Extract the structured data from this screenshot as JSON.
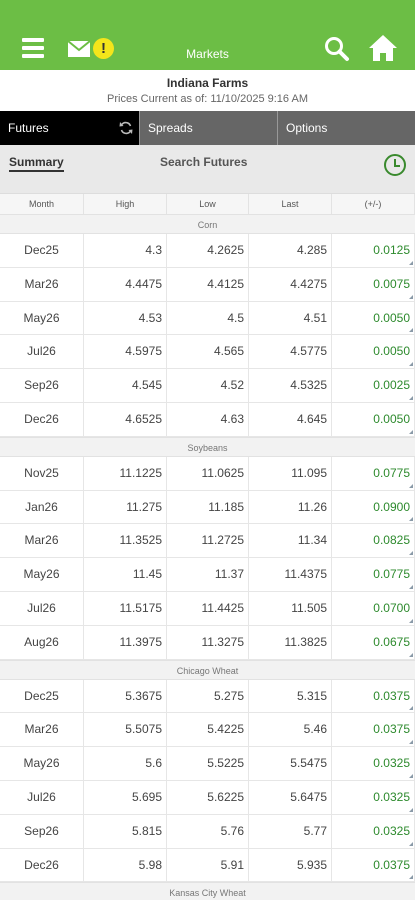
{
  "header": {
    "title": "Markets",
    "alert_badge": "!"
  },
  "company": "Indiana Farms",
  "as_of": "Prices Current as of: 11/10/2025 9:16 AM",
  "tabs": {
    "futures": "Futures",
    "spreads": "Spreads",
    "options": "Options"
  },
  "subnav": {
    "summary": "Summary",
    "search": "Search Futures"
  },
  "columns": [
    "Month",
    "High",
    "Low",
    "Last",
    "(+/-)"
  ],
  "groups": [
    {
      "name": "Corn",
      "rows": [
        [
          "Dec25",
          "4.3",
          "4.2625",
          "4.285",
          "0.0125"
        ],
        [
          "Mar26",
          "4.4475",
          "4.4125",
          "4.4275",
          "0.0075"
        ],
        [
          "May26",
          "4.53",
          "4.5",
          "4.51",
          "0.0050"
        ],
        [
          "Jul26",
          "4.5975",
          "4.565",
          "4.5775",
          "0.0050"
        ],
        [
          "Sep26",
          "4.545",
          "4.52",
          "4.5325",
          "0.0025"
        ],
        [
          "Dec26",
          "4.6525",
          "4.63",
          "4.645",
          "0.0050"
        ]
      ]
    },
    {
      "name": "Soybeans",
      "rows": [
        [
          "Nov25",
          "11.1225",
          "11.0625",
          "11.095",
          "0.0775"
        ],
        [
          "Jan26",
          "11.275",
          "11.185",
          "11.26",
          "0.0900"
        ],
        [
          "Mar26",
          "11.3525",
          "11.2725",
          "11.34",
          "0.0825"
        ],
        [
          "May26",
          "11.45",
          "11.37",
          "11.4375",
          "0.0775"
        ],
        [
          "Jul26",
          "11.5175",
          "11.4425",
          "11.505",
          "0.0700"
        ],
        [
          "Aug26",
          "11.3975",
          "11.3275",
          "11.3825",
          "0.0675"
        ]
      ]
    },
    {
      "name": "Chicago Wheat",
      "rows": [
        [
          "Dec25",
          "5.3675",
          "5.275",
          "5.315",
          "0.0375"
        ],
        [
          "Mar26",
          "5.5075",
          "5.4225",
          "5.46",
          "0.0375"
        ],
        [
          "May26",
          "5.6",
          "5.5225",
          "5.5475",
          "0.0325"
        ],
        [
          "Jul26",
          "5.695",
          "5.6225",
          "5.6475",
          "0.0325"
        ],
        [
          "Sep26",
          "5.815",
          "5.76",
          "5.77",
          "0.0325"
        ],
        [
          "Dec26",
          "5.98",
          "5.91",
          "5.935",
          "0.0375"
        ]
      ]
    },
    {
      "name": "Kansas City Wheat",
      "rows": []
    }
  ],
  "colors": {
    "brand_green": "#6cbe45",
    "change_green": "#2d8a2d",
    "tab_active": "#000000",
    "tab_inactive": "#666666"
  },
  "icons": [
    "menu-icon",
    "mail-icon",
    "alert-icon",
    "search-icon",
    "home-icon",
    "refresh-icon",
    "clock-icon"
  ]
}
